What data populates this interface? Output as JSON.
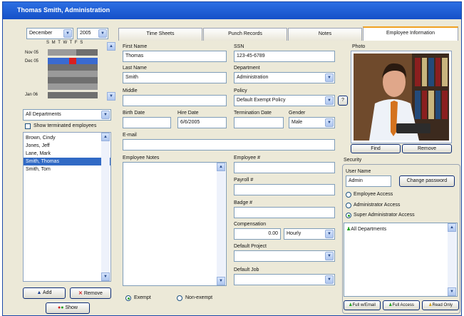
{
  "window": {
    "title": "Thomas Smith, Administration"
  },
  "calendar": {
    "month": "December",
    "year": "2005",
    "weekday_header": "S M T W T F S",
    "month_labels": [
      "Nov 05",
      "Dec 05",
      "Jan 06"
    ]
  },
  "department_filter": {
    "value": "All Departments"
  },
  "show_terminated": {
    "label": "Show terminated employees",
    "checked": false
  },
  "employees": [
    "Brown, Cindy",
    "Jones, Jeff",
    "Lane, Mark",
    "Smith, Thomas",
    "Smith, Tom"
  ],
  "employees_selected_index": 3,
  "buttons": {
    "add": "Add",
    "remove": "Remove",
    "show": "Show"
  },
  "tabs": [
    "Time Sheets",
    "Punch Records",
    "Notes",
    "Employee Information"
  ],
  "active_tab": 3,
  "form": {
    "first_name_label": "First Name",
    "first_name": "Thomas",
    "last_name_label": "Last Name",
    "last_name": "Smith",
    "middle_label": "Middle",
    "middle": "",
    "ssn_label": "SSN",
    "ssn": "123-45-6789",
    "department_label": "Department",
    "department": "Administration",
    "policy_label": "Policy",
    "policy": "Default Exempt Policy",
    "policy_help": "?",
    "birth_date_label": "Birth Date",
    "birth_date": "",
    "hire_date_label": "Hire Date",
    "hire_date": "6/6/2005",
    "termination_date_label": "Termination Date",
    "termination_date": "",
    "gender_label": "Gender",
    "gender": "Male",
    "email_label": "E-mail",
    "email": "",
    "notes_label": "Employee Notes",
    "employee_num_label": "Employee #",
    "employee_num": "",
    "payroll_num_label": "Payroll #",
    "payroll_num": "",
    "badge_num_label": "Badge #",
    "badge_num": "",
    "compensation_label": "Compensation",
    "compensation": "0.00",
    "compensation_period": "Hourly",
    "default_project_label": "Default Project",
    "default_project": "",
    "default_job_label": "Default Job",
    "default_job": "",
    "exempt_label": "Exempt",
    "non_exempt_label": "Non-exempt",
    "exempt_selected": true
  },
  "photo": {
    "label": "Photo",
    "find": "Find",
    "remove": "Remove"
  },
  "security": {
    "label": "Security",
    "user_name_label": "User Name",
    "user_name": "Admin",
    "change_password": "Change password",
    "access_levels": [
      "Employee Access",
      "Administrator Access",
      "Super Administrator Access"
    ],
    "selected_access": 2,
    "departments": [
      "All Departments"
    ],
    "footer_buttons": [
      "Full w/Email",
      "Full Access",
      "Read Only"
    ]
  },
  "colors": {
    "titlebar": "#1550c8",
    "selection": "#316ac5",
    "accent_tab": "#f0a020"
  }
}
